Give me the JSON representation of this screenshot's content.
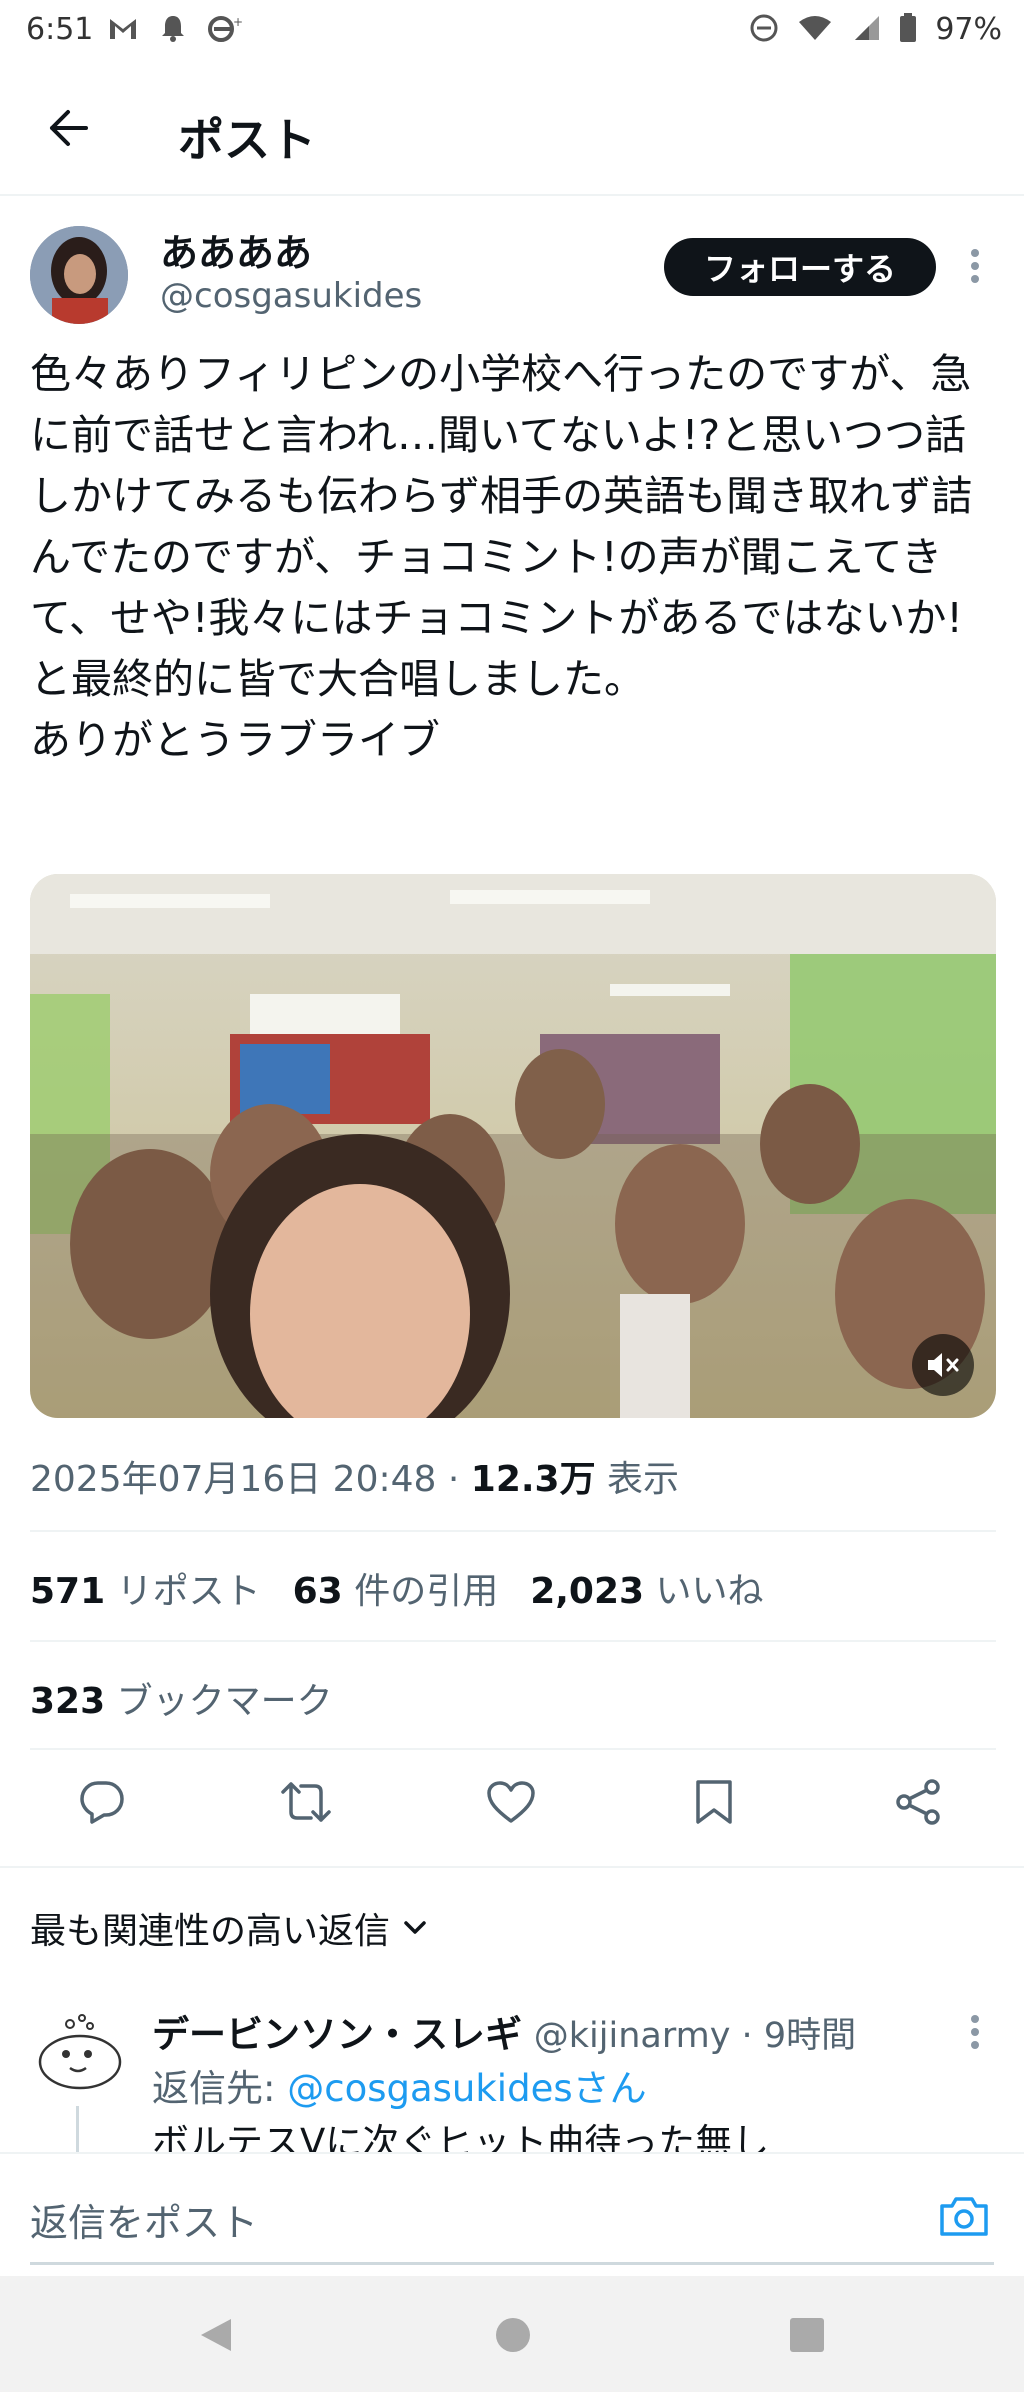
{
  "status_bar": {
    "time": "6:51",
    "battery": "97%",
    "icons": [
      "gmail-icon",
      "notification-bell-icon",
      "edge-icon",
      "dnd-icon",
      "wifi-icon",
      "signal-icon",
      "battery-icon"
    ]
  },
  "header": {
    "title": "ポスト"
  },
  "author": {
    "name": "ああああ",
    "handle": "@cosgasukides",
    "follow_label": "フォローする"
  },
  "tweet": {
    "text": "色々ありフィリピンの小学校へ行ったのですが、急に前で話せと言われ…聞いてないよ!?と思いつつ話しかけてみるも伝わらず相手の英語も聞き取れず詰んでたのですが、チョコミント!の声が聞こえてきて、せや!我々にはチョコミントがあるではないか!と最終的に皆で大合唱しました。\nありがとうラブライブ",
    "datetime": "2025年07月16日 20:48",
    "separator": " · ",
    "views_count": "12.3万",
    "views_label": " 表示"
  },
  "stats": {
    "reposts_count": "571",
    "reposts_label": "リポスト",
    "quotes_count": "63",
    "quotes_label": "件の引用",
    "likes_count": "2,023",
    "likes_label": "いいね",
    "bookmarks_count": "323",
    "bookmarks_label": "ブックマーク"
  },
  "sort": {
    "label": "最も関連性の高い返信"
  },
  "reply": {
    "name": "デービンソン・スレギ",
    "handle": "@kijinarmy",
    "time": "9時間",
    "separator": " · ",
    "reply_to_prefix": "返信先: ",
    "reply_to_handle": "@cosgasukidesさん",
    "text": "ボルテスVに次ぐヒット曲待った無し"
  },
  "compose": {
    "placeholder": "返信をポスト"
  },
  "colors": {
    "accent": "#1d9bf0",
    "text": "#0f1419",
    "muted": "#536471",
    "divider": "#eff3f4"
  }
}
